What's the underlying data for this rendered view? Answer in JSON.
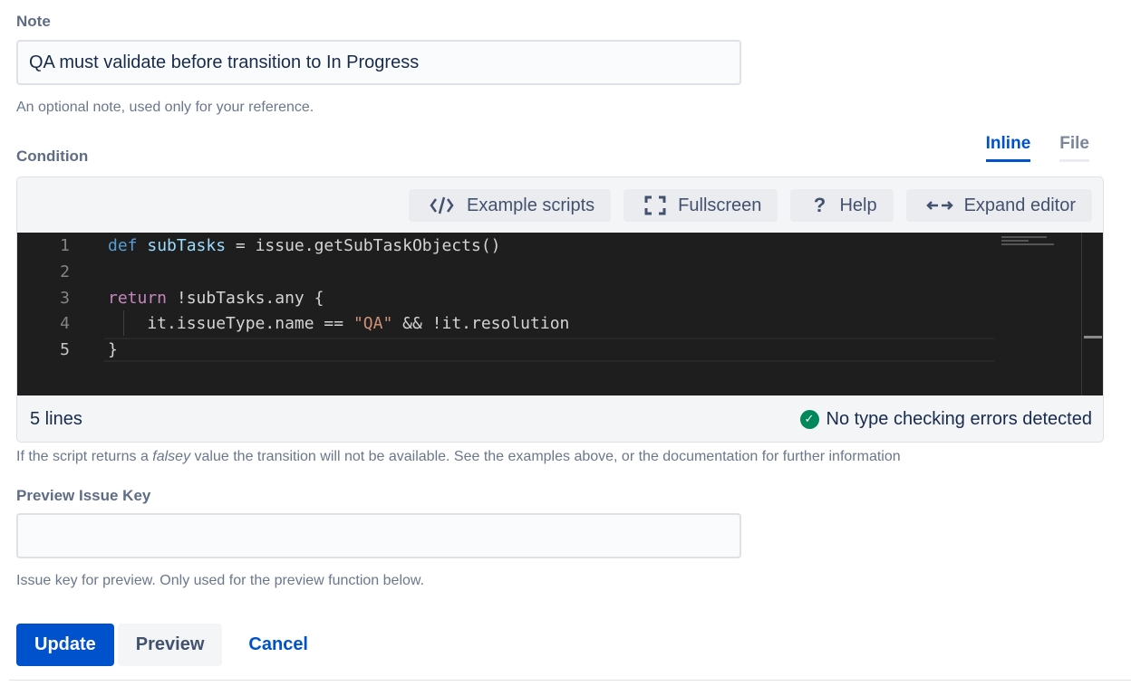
{
  "note": {
    "label": "Note",
    "value": "QA must validate before transition to In Progress",
    "helper": "An optional note, used only for your reference."
  },
  "condition": {
    "label": "Condition",
    "tabs": [
      {
        "label": "Inline",
        "active": true
      },
      {
        "label": "File",
        "active": false
      }
    ],
    "toolbar": [
      {
        "icon": "code-icon",
        "glyph": "</>",
        "label": "Example scripts"
      },
      {
        "icon": "fullscreen-icon",
        "glyph": "[ ]",
        "label": "Fullscreen"
      },
      {
        "icon": "help-icon",
        "glyph": "?",
        "label": "Help"
      },
      {
        "icon": "expand-icon",
        "glyph": "↔",
        "label": "Expand editor"
      }
    ],
    "code_lines": [
      {
        "num": "1",
        "text": "def subTasks = issue.getSubTaskObjects()"
      },
      {
        "num": "2",
        "text": ""
      },
      {
        "num": "3",
        "text": "return !subTasks.any {"
      },
      {
        "num": "4",
        "text": "    it.issueType.name == \"QA\" && !it.resolution"
      },
      {
        "num": "5",
        "text": "}"
      }
    ],
    "current_line": 5,
    "line_count": "5 lines",
    "type_check_status": "No type checking errors detected",
    "helper_prefix": "If the script returns a ",
    "helper_em": "falsey",
    "helper_suffix": " value the transition will not be available. See the examples above, or the documentation for further information"
  },
  "preview_key": {
    "label": "Preview Issue Key",
    "value": "",
    "placeholder": "",
    "helper": "Issue key for preview. Only used for the preview function below."
  },
  "actions": {
    "update": "Update",
    "preview": "Preview",
    "cancel": "Cancel"
  },
  "colors": {
    "primary": "#0052cc",
    "success": "#00875a",
    "editor_bg": "#1e1e1e"
  }
}
